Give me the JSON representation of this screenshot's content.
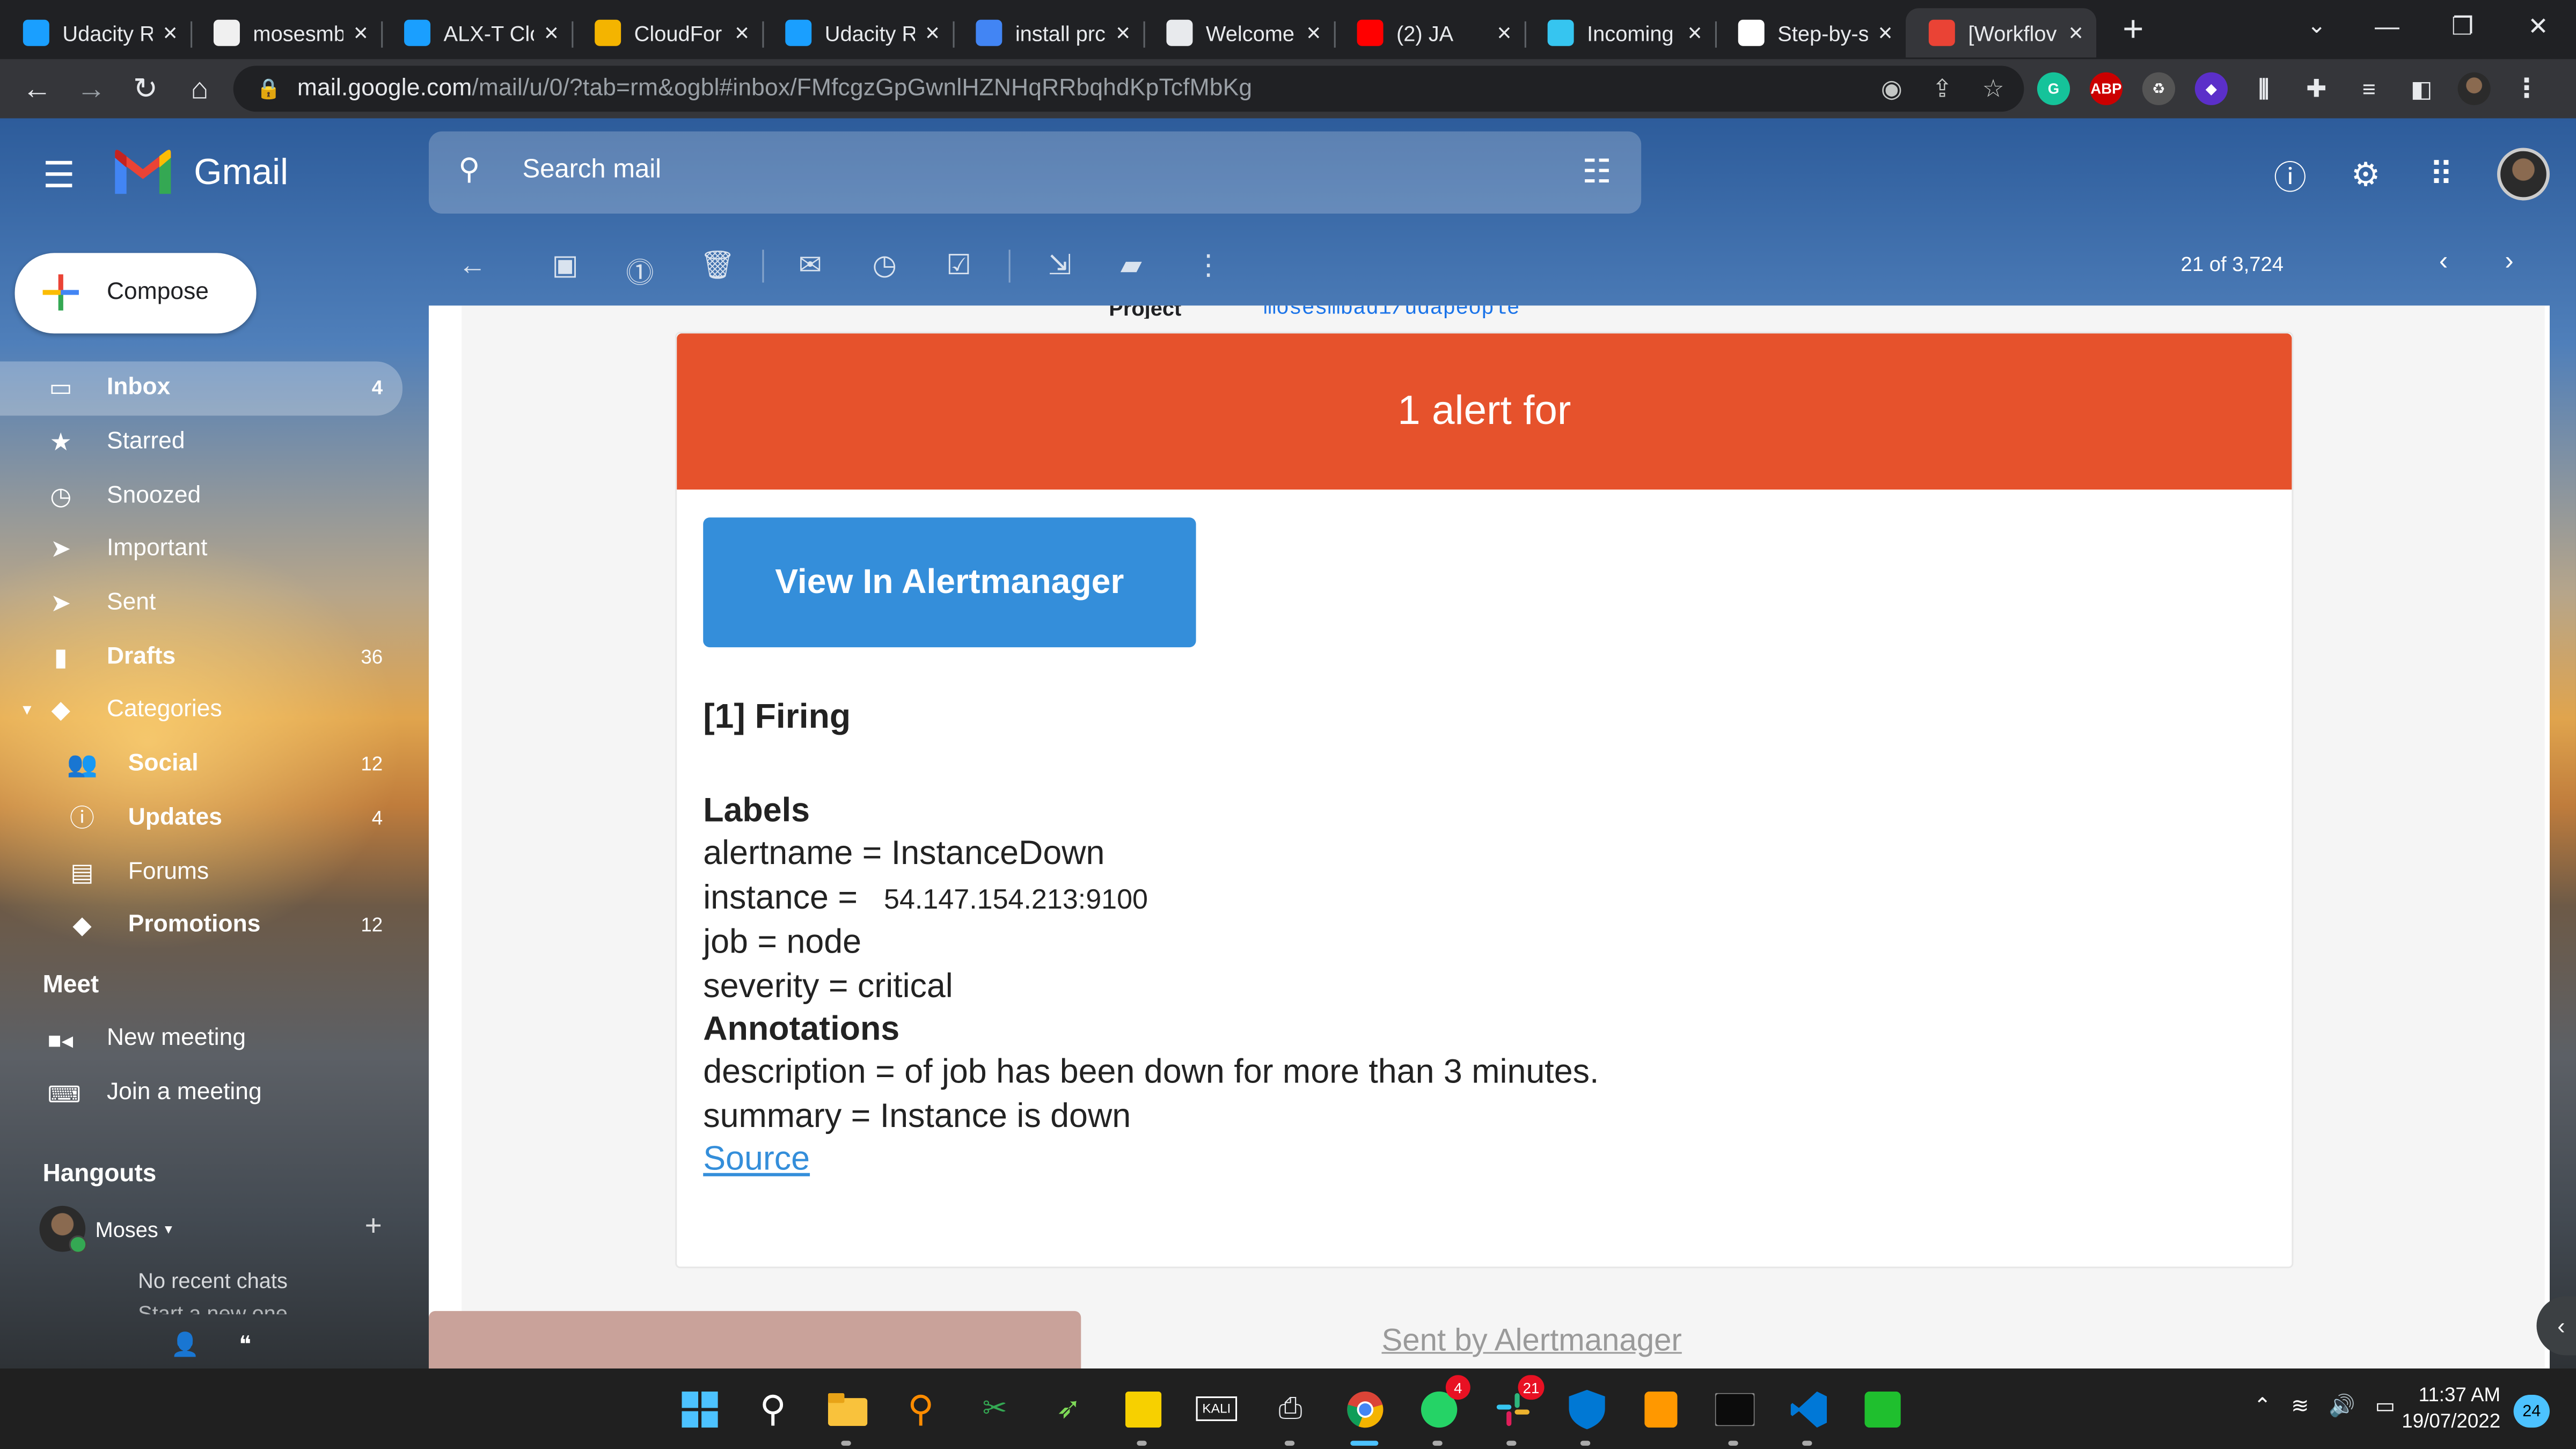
{
  "browser": {
    "tabs": [
      {
        "title": "Udacity R",
        "icon": "udacity-icon",
        "color": "#1a9fff"
      },
      {
        "title": "mosesmb",
        "icon": "github-icon",
        "color": "#f0f0f0"
      },
      {
        "title": "ALX-T Clo",
        "icon": "udacity-icon",
        "color": "#1a9fff"
      },
      {
        "title": "CloudFor",
        "icon": "cloudformation-icon",
        "color": "#f4b400"
      },
      {
        "title": "Udacity R",
        "icon": "udacity-icon",
        "color": "#1a9fff"
      },
      {
        "title": "install prc",
        "icon": "google-icon",
        "color": "#4285f4"
      },
      {
        "title": "Welcome",
        "icon": "globe-icon",
        "color": "#e8eaed"
      },
      {
        "title": "(2) JA",
        "icon": "youtube-icon",
        "color": "#ff0000"
      },
      {
        "title": "Incoming",
        "icon": "slack-icon",
        "color": "#36c5f0"
      },
      {
        "title": "Step-by-s",
        "icon": "medium-icon",
        "color": "#ffffff"
      },
      {
        "title": "[Workflov",
        "icon": "gmail-icon",
        "color": "#ea4335",
        "active": true
      }
    ],
    "url_host": "mail.google.com",
    "url_path": "/mail/u/0/?tab=rm&ogbl#inbox/FMfcgzGpGwnlHZNHqRRbqhdKpTcfMbKg"
  },
  "gmail": {
    "brand": "Gmail",
    "search_placeholder": "Search mail",
    "compose_label": "Compose",
    "nav": [
      {
        "label": "Inbox",
        "count": "4",
        "icon": "inbox-icon",
        "active": true
      },
      {
        "label": "Starred",
        "count": "",
        "icon": "star-icon"
      },
      {
        "label": "Snoozed",
        "count": "",
        "icon": "clock-icon"
      },
      {
        "label": "Important",
        "count": "",
        "icon": "important-icon"
      },
      {
        "label": "Sent",
        "count": "",
        "icon": "send-icon"
      },
      {
        "label": "Drafts",
        "count": "36",
        "icon": "draft-icon",
        "bold": true
      },
      {
        "label": "Categories",
        "count": "",
        "icon": "label-icon"
      },
      {
        "label": "Social",
        "count": "12",
        "icon": "people-icon",
        "bold": true,
        "sub": true
      },
      {
        "label": "Updates",
        "count": "4",
        "icon": "info-icon",
        "bold": true,
        "sub": true
      },
      {
        "label": "Forums",
        "count": "",
        "icon": "forum-icon",
        "sub": true
      },
      {
        "label": "Promotions",
        "count": "12",
        "icon": "tag-icon",
        "bold": true,
        "sub": true
      }
    ],
    "meet_title": "Meet",
    "meet_items": [
      "New meeting",
      "Join a meeting"
    ],
    "hangouts_title": "Hangouts",
    "hangouts_user": "Moses",
    "no_recent_chats": "No recent chats",
    "start_new": "Start a new one",
    "pager": "21 of 3,724"
  },
  "email": {
    "clipped_key": "Project",
    "clipped_value": "mosesmbadi/udapeople",
    "banner": "1 alert for",
    "button": "View In Alertmanager",
    "firing": "[1] Firing",
    "labels_title": "Labels",
    "alertname": "alertname = InstanceDown",
    "instance_key": "instance =",
    "instance_val": "54.147.154.213:9100",
    "job": "job = node",
    "severity": "severity = critical",
    "annotations_title": "Annotations",
    "description": "description = of job has been down for more than 3 minutes.",
    "summary": "summary = Instance is down",
    "source": "Source",
    "sent_by": "Sent by Alertmanager"
  },
  "taskbar": {
    "time": "11:37 AM",
    "date": "19/07/2022",
    "notifications": "24",
    "whatsapp_badge": "4",
    "slack_badge": "21",
    "kali_label": "KALI"
  }
}
